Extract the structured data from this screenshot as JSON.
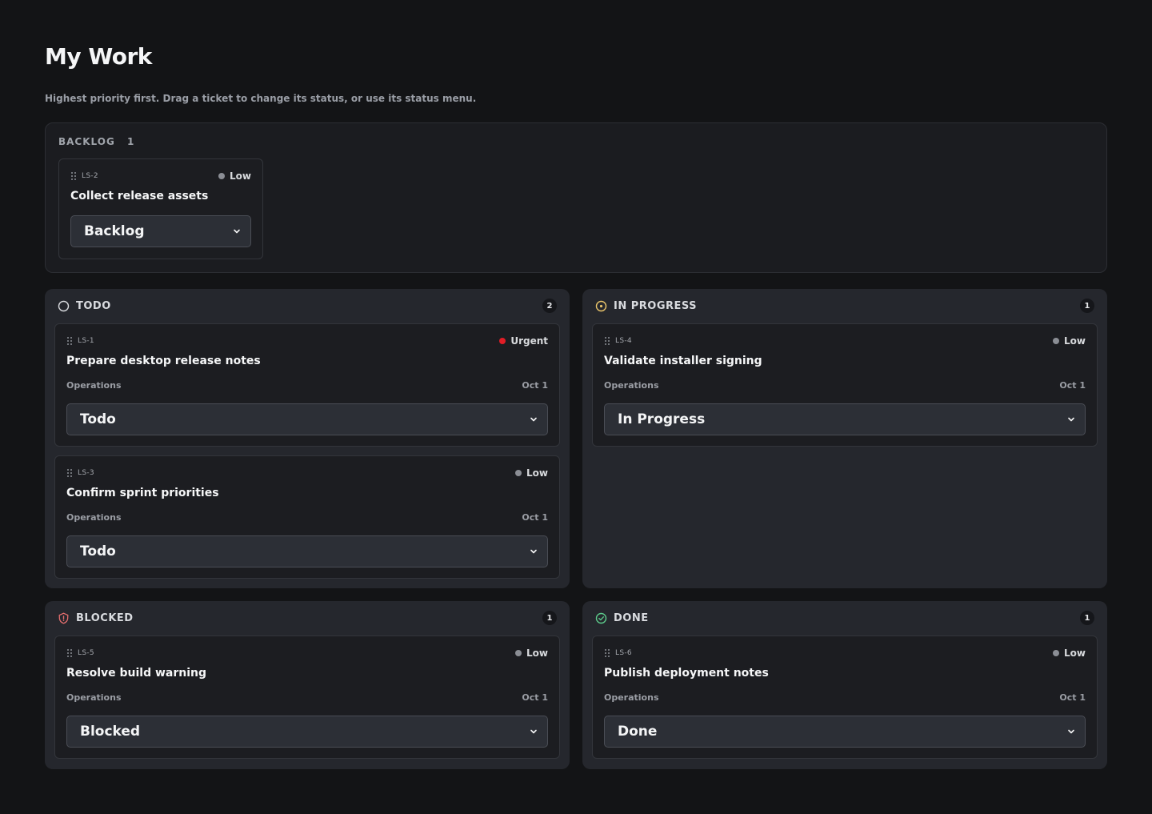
{
  "page": {
    "title": "My Work",
    "subtitle": "Highest priority first. Drag a ticket to change its status, or use its status menu."
  },
  "backlog": {
    "title": "BACKLOG",
    "count": "1",
    "cards": [
      {
        "id": "LS-2",
        "priority": "Low",
        "title": "Collect release assets",
        "status": "Backlog"
      }
    ]
  },
  "columns": {
    "todo": {
      "title": "TODO",
      "count": "2",
      "cards": [
        {
          "id": "LS-1",
          "priority": "Urgent",
          "title": "Prepare desktop release notes",
          "team": "Operations",
          "date": "Oct 1",
          "status": "Todo"
        },
        {
          "id": "LS-3",
          "priority": "Low",
          "title": "Confirm sprint priorities",
          "team": "Operations",
          "date": "Oct 1",
          "status": "Todo"
        }
      ]
    },
    "in_progress": {
      "title": "IN PROGRESS",
      "count": "1",
      "cards": [
        {
          "id": "LS-4",
          "priority": "Low",
          "title": "Validate installer signing",
          "team": "Operations",
          "date": "Oct 1",
          "status": "In Progress"
        }
      ]
    },
    "blocked": {
      "title": "BLOCKED",
      "count": "1",
      "cards": [
        {
          "id": "LS-5",
          "priority": "Low",
          "title": "Resolve build warning",
          "team": "Operations",
          "date": "Oct 1",
          "status": "Blocked"
        }
      ]
    },
    "done": {
      "title": "DONE",
      "count": "1",
      "cards": [
        {
          "id": "LS-6",
          "priority": "Low",
          "title": "Publish deployment notes",
          "team": "Operations",
          "date": "Oct 1",
          "status": "Done"
        }
      ]
    }
  },
  "colors": {
    "background": "#131416",
    "column": "#25272d",
    "card": "#1c1d21",
    "urgent": "#e11d26",
    "low": "#8b8e95",
    "in_progress_icon": "#e9c46a",
    "blocked_icon": "#e26d6d",
    "done_icon": "#5cc98a"
  },
  "icons": {
    "todo": "circle-icon",
    "in_progress": "dot-circle-icon",
    "blocked": "shield-alert-icon",
    "done": "check-circle-icon",
    "drag": "drag-handle-icon",
    "select": "chevron-down-icon"
  }
}
